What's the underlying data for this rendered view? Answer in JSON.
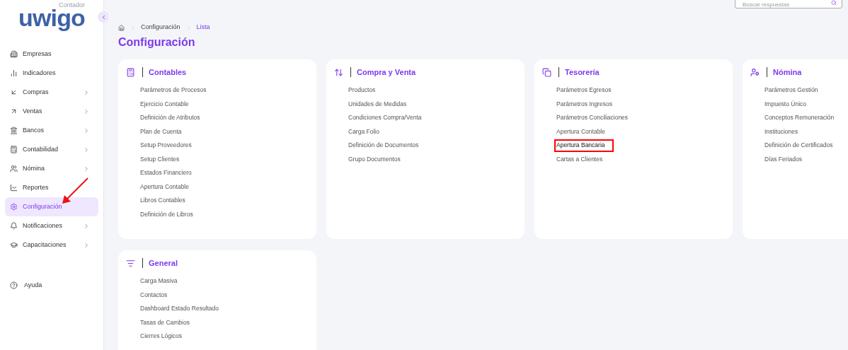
{
  "logo": {
    "name": "uwigo",
    "tagline": "Contador"
  },
  "sidebar": {
    "items": [
      {
        "label": "Empresas",
        "has_submenu": false,
        "selected": false
      },
      {
        "label": "Indicadores",
        "has_submenu": false,
        "selected": false
      },
      {
        "label": "Compras",
        "has_submenu": true,
        "selected": false
      },
      {
        "label": "Ventas",
        "has_submenu": true,
        "selected": false
      },
      {
        "label": "Bancos",
        "has_submenu": true,
        "selected": false
      },
      {
        "label": "Contabilidad",
        "has_submenu": true,
        "selected": false
      },
      {
        "label": "Nómina",
        "has_submenu": true,
        "selected": false
      },
      {
        "label": "Reportes",
        "has_submenu": false,
        "selected": false
      },
      {
        "label": "Configuración",
        "has_submenu": false,
        "selected": true
      },
      {
        "label": "Notificaciones",
        "has_submenu": true,
        "selected": false
      },
      {
        "label": "Capacitaciones",
        "has_submenu": true,
        "selected": false
      }
    ],
    "help": "Ayuda"
  },
  "search": {
    "placeholder": "Buscar respuestas"
  },
  "breadcrumb": [
    "Configuración",
    "Lista"
  ],
  "page_title": "Configuración",
  "cards": [
    {
      "title": "Contables",
      "items": [
        {
          "label": "Parámetros de Procesos",
          "highlighted": false
        },
        {
          "label": "Ejercicio Contable",
          "highlighted": false
        },
        {
          "label": "Definición de Atributos",
          "highlighted": false
        },
        {
          "label": "Plan de Cuenta",
          "highlighted": false
        },
        {
          "label": "Setup Proveedores",
          "highlighted": false
        },
        {
          "label": "Setup Clientes",
          "highlighted": false
        },
        {
          "label": "Estados Financiero",
          "highlighted": false
        },
        {
          "label": "Apertura Contable",
          "highlighted": false
        },
        {
          "label": "Libros Contables",
          "highlighted": false
        },
        {
          "label": "Definición de Libros",
          "highlighted": false
        }
      ]
    },
    {
      "title": "Compra y Venta",
      "items": [
        {
          "label": "Productos",
          "highlighted": false
        },
        {
          "label": "Unidades de Medidas",
          "highlighted": false
        },
        {
          "label": "Condiciones Compra/Venta",
          "highlighted": false
        },
        {
          "label": "Carga Folio",
          "highlighted": false
        },
        {
          "label": "Definición de Documentos",
          "highlighted": false
        },
        {
          "label": "Grupo Documentos",
          "highlighted": false
        }
      ]
    },
    {
      "title": "Tesorería",
      "items": [
        {
          "label": "Parámetros Egresos",
          "highlighted": false
        },
        {
          "label": "Parámetros Ingresos",
          "highlighted": false
        },
        {
          "label": "Parámetros Conciliaciones",
          "highlighted": false
        },
        {
          "label": "Apertura Contable",
          "highlighted": false
        },
        {
          "label": "Apertura Bancaria",
          "highlighted": true
        },
        {
          "label": "Cartas a Clientes",
          "highlighted": false
        }
      ]
    },
    {
      "title": "Nómina",
      "items": [
        {
          "label": "Parámetros Gestión",
          "highlighted": false
        },
        {
          "label": "Impuesto Único",
          "highlighted": false
        },
        {
          "label": "Conceptos Remuneración",
          "highlighted": false
        },
        {
          "label": "Instituciones",
          "highlighted": false
        },
        {
          "label": "Definición de Certificados",
          "highlighted": false
        },
        {
          "label": "Días Feriados",
          "highlighted": false
        }
      ]
    },
    {
      "title": "General",
      "items": [
        {
          "label": "Carga Masiva",
          "highlighted": false
        },
        {
          "label": "Contactos",
          "highlighted": false
        },
        {
          "label": "Dashboard Estado Resultado",
          "highlighted": false
        },
        {
          "label": "Tasas de Cambios",
          "highlighted": false
        },
        {
          "label": "Cierres Lógicos",
          "highlighted": false
        }
      ]
    }
  ]
}
